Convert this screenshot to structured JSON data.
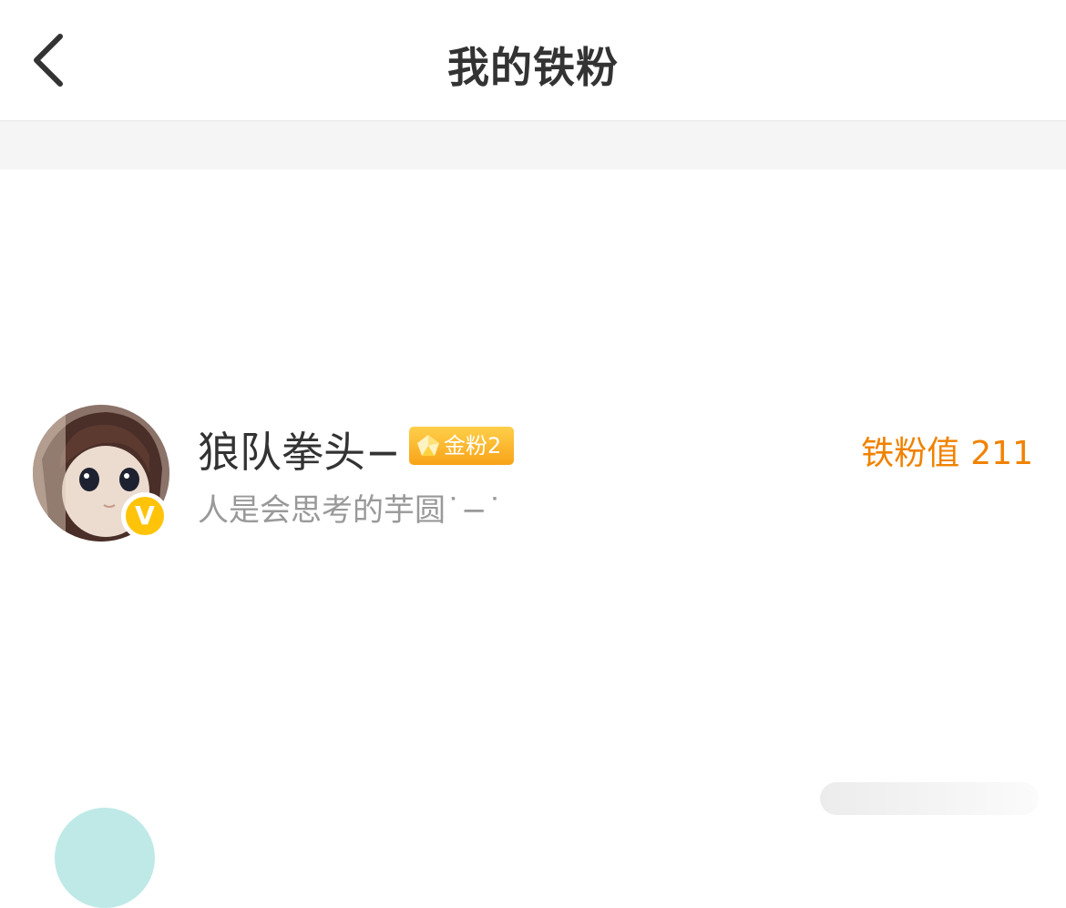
{
  "nav": {
    "back_icon": "chevron-left-icon",
    "title": "我的铁粉"
  },
  "fans": [
    {
      "name": "狼队拳头−",
      "badge": "金粉2",
      "badge_icon": "pentagon-gem-icon",
      "verified_badge": "V",
      "bio": "人是会思考的芋圆˙−˙",
      "score_label": "铁粉值",
      "score_value": "211"
    }
  ],
  "colors": {
    "accent_orange": "#f08200",
    "badge_gold": "#ffc40a",
    "divider_bg": "#f5f5f5"
  }
}
